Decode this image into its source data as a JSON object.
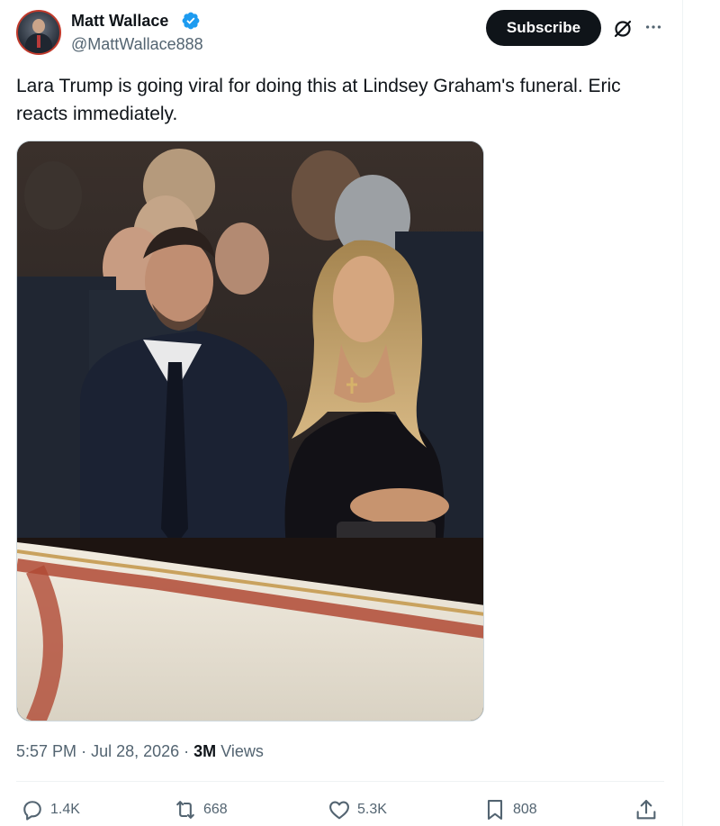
{
  "author": {
    "display_name": "Matt Wallace",
    "handle": "@MattWallace888",
    "verified": true
  },
  "header": {
    "subscribe_label": "Subscribe"
  },
  "tweet": {
    "text": "Lara Trump is going viral for doing this at Lindsey Graham's funeral. Eric reacts immediately.",
    "time": "5:57 PM",
    "date": "Jul 28, 2026",
    "views_count": "3M",
    "views_label": "Views"
  },
  "actions": {
    "replies": "1.4K",
    "reposts": "668",
    "likes": "5.3K",
    "bookmarks": "808"
  },
  "colors": {
    "text": "#0f1419",
    "secondary": "#536471",
    "verified": "#1d9bf0",
    "button": "#0f1419",
    "divider": "#eff3f4"
  },
  "icons": [
    "verified-icon",
    "grok-icon",
    "more-icon",
    "reply-icon",
    "repost-icon",
    "like-icon",
    "bookmark-icon",
    "share-icon"
  ]
}
